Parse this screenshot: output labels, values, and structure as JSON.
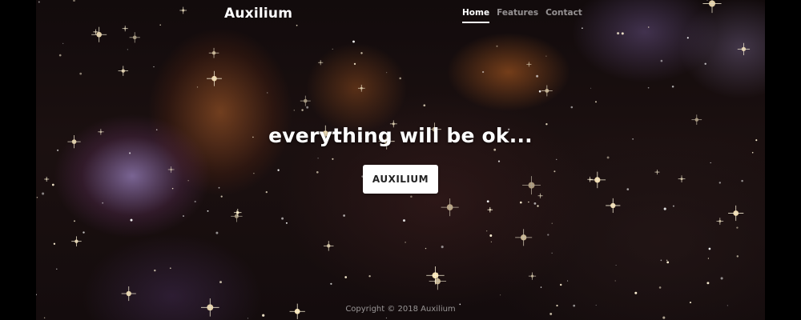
{
  "brand": {
    "name": "Auxilium"
  },
  "nav": {
    "items": [
      {
        "label": "Home",
        "active": true
      },
      {
        "label": "Features",
        "active": false
      },
      {
        "label": "Contact",
        "active": false
      }
    ]
  },
  "hero": {
    "headline": "everything will be ok...",
    "button_label": "AUXILIUM"
  },
  "footer": {
    "copyright": "Copyright © 2018 Auxilium"
  },
  "colors": {
    "background": "#000000",
    "text": "#ffffff",
    "button_bg": "#ffffff",
    "button_text": "#222222"
  }
}
